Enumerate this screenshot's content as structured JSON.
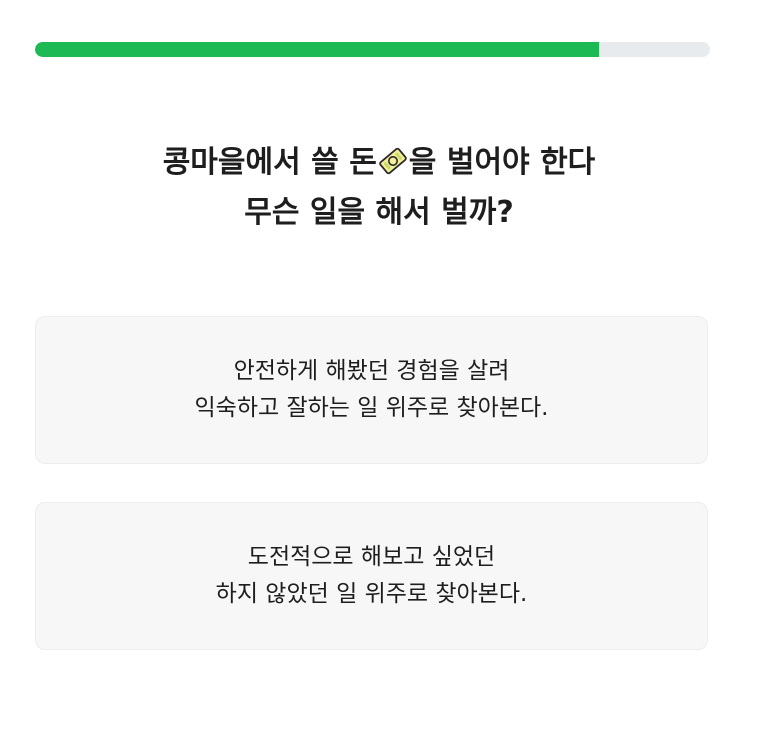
{
  "progress": {
    "value": 0.835
  },
  "question": {
    "line1_before_icon": "콩마을에서 쓸 돈",
    "icon": "money-bill-icon",
    "line1_after_icon": "을 벌어야 한다",
    "line2": "무슨 일을 해서 벌까?"
  },
  "options": [
    {
      "line1": "안전하게 해봤던 경험을 살려",
      "line2": "익숙하고 잘하는 일 위주로 찾아본다."
    },
    {
      "line1": "도전적으로 해보고 싶었던",
      "line2": "하지 않았던 일 위주로 찾아본다."
    }
  ],
  "colors": {
    "progress_fill": "#1db954",
    "progress_track": "#e8ebee",
    "card_background": "#f7f7f7"
  }
}
